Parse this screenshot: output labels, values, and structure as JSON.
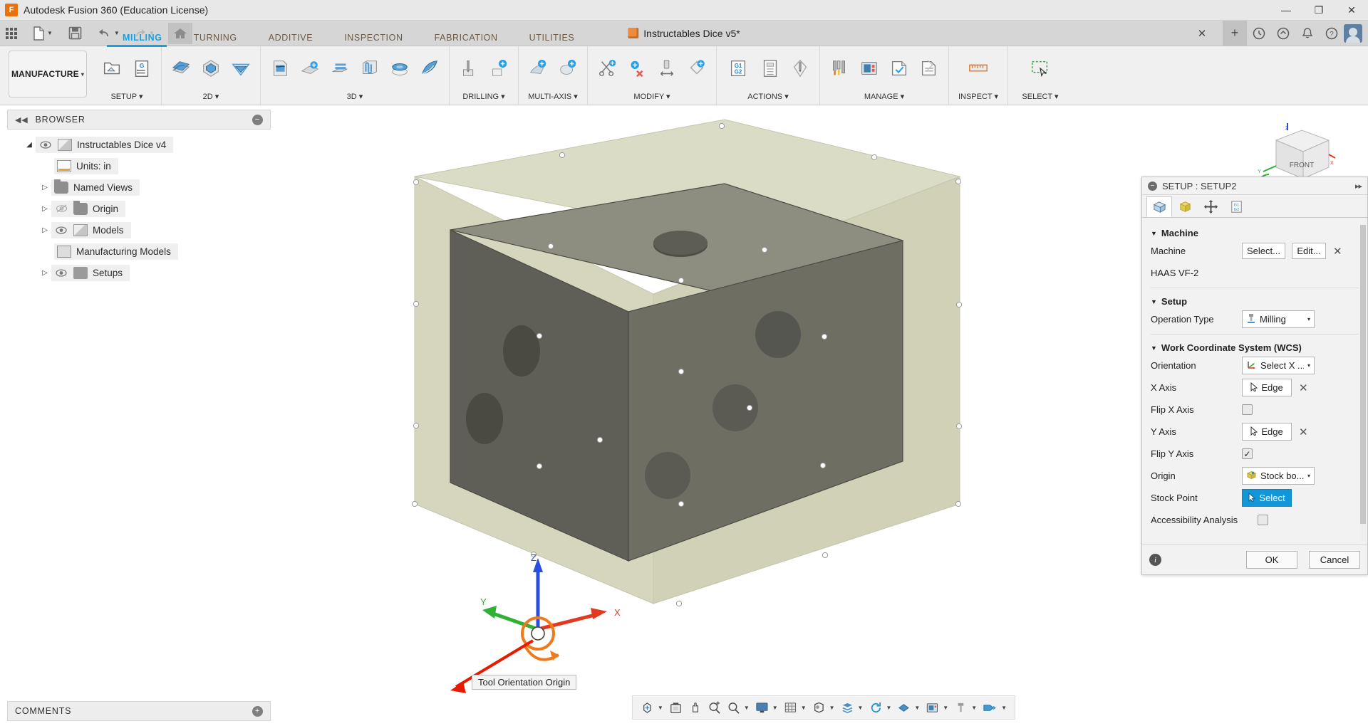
{
  "titlebar": {
    "app_title": "Autodesk Fusion 360 (Education License)",
    "minimize": "—",
    "maximize": "❐",
    "close": "✕",
    "logo_icon": "fusion-logo-icon"
  },
  "quick_access": {
    "grid_icon": "app-grid-icon",
    "new_icon": "new-document-icon",
    "save_icon": "save-icon",
    "undo_icon": "undo-icon",
    "redo_icon": "redo-icon",
    "home_icon": "home-icon",
    "document_name": "Instructables Dice v5*",
    "document_close": "✕",
    "add_tab": "+",
    "help_icon": "help-icon",
    "notify_icon": "notification-icon",
    "alerts_icon": "alerts-icon",
    "job_icon": "job-status-icon",
    "avatar": "user-avatar"
  },
  "ribbon": {
    "workspace": "MANUFACTURE",
    "workspace_caret": "▾",
    "tabs": [
      {
        "label": "MILLING",
        "active": true
      },
      {
        "label": "TURNING",
        "active": false
      },
      {
        "label": "ADDITIVE",
        "active": false
      },
      {
        "label": "INSPECTION",
        "active": false
      },
      {
        "label": "FABRICATION",
        "active": false
      },
      {
        "label": "UTILITIES",
        "active": false
      }
    ],
    "panels": [
      {
        "label": "SETUP ▾",
        "icons": [
          "setup-icon",
          "generate-nc-program-icon"
        ]
      },
      {
        "label": "2D ▾",
        "icons": [
          "face-icon",
          "adaptive-2d-icon",
          "pocket-2d-icon"
        ]
      },
      {
        "label": "3D ▾",
        "icons": [
          "adaptive-3d-icon",
          "pocket-clearing-icon",
          "parallel-icon",
          "contour-icon",
          "ramp-icon",
          "scallop-icon"
        ]
      },
      {
        "label": "DRILLING ▾",
        "icons": [
          "drill-icon",
          "bore-icon",
          "thread-icon"
        ]
      },
      {
        "label": "MULTI-AXIS ▾",
        "icons": [
          "swarf-icon",
          "multi-axis-contour-icon",
          "rotary-icon"
        ]
      },
      {
        "label": "MODIFY ▾",
        "icons": [
          "trim-icon",
          "delete-toolpath-icon",
          "extend-icon",
          "transform-icon"
        ]
      },
      {
        "label": "ACTIONS ▾",
        "icons": [
          "post-process-icon",
          "setup-sheet-icon",
          "simulate-icon"
        ]
      },
      {
        "label": "MANAGE ▾",
        "icons": [
          "tool-library-icon",
          "machine-library-icon",
          "generate-icon",
          "template-icon"
        ]
      },
      {
        "label": "INSPECT ▾",
        "icons": [
          "measure-icon"
        ]
      },
      {
        "label": "SELECT ▾",
        "icons": [
          "select-window-icon"
        ]
      }
    ]
  },
  "browser": {
    "title": "BROWSER",
    "collapse_icon": "collapse-left-icon",
    "minimize_icon": "−",
    "nodes": [
      {
        "label": "Instructables Dice v4",
        "indent": 0,
        "arrow": "◢",
        "eye": true,
        "icon": "body-icon"
      },
      {
        "label": "Units: in",
        "indent": 1,
        "arrow": "",
        "eye": false,
        "icon": "units-document-icon"
      },
      {
        "label": "Named Views",
        "indent": 1,
        "arrow": "▷",
        "eye": false,
        "icon": "folder-icon"
      },
      {
        "label": "Origin",
        "indent": 1,
        "arrow": "▷",
        "eye": true,
        "eye_off": true,
        "icon": "folder-icon"
      },
      {
        "label": "Models",
        "indent": 1,
        "arrow": "▷",
        "eye": true,
        "icon": "body-icon"
      },
      {
        "label": "Manufacturing Models",
        "indent": 1,
        "arrow": "",
        "eye": false,
        "icon": "manufacturing-model-icon"
      },
      {
        "label": "Setups",
        "indent": 1,
        "arrow": "▷",
        "eye": true,
        "icon": "folder-open-icon"
      }
    ]
  },
  "comments": {
    "title": "COMMENTS",
    "add_icon": "+"
  },
  "canvas": {
    "tooltip": "Tool Orientation Origin",
    "viewcube": {
      "front_label": "FRONT",
      "z_label": "Z",
      "x_label": "X",
      "y_label": "Y"
    },
    "triad": {
      "x": "X",
      "y": "Y",
      "z": "Z"
    },
    "colors": {
      "stock": "#cfd0b3",
      "model": "#6e6e63",
      "x_axis": "#e23a1e",
      "y_axis": "#2fb134",
      "z_axis": "#2a4fe0",
      "highlight": "#f07a1a"
    }
  },
  "navbar": {
    "items": [
      {
        "icon": "orbit-icon",
        "caret": true
      },
      {
        "icon": "look-at-icon",
        "caret": false
      },
      {
        "icon": "pan-icon",
        "caret": false
      },
      {
        "icon": "zoom-in-icon",
        "caret": false
      },
      {
        "icon": "zoom-window-icon",
        "caret": true
      },
      {
        "icon": "display-settings-icon",
        "caret": true
      },
      {
        "icon": "grid-snaps-icon",
        "caret": true
      },
      {
        "icon": "viewports-icon",
        "caret": true
      },
      {
        "icon": "layers-icon",
        "caret": true
      },
      {
        "icon": "refresh-icon",
        "caret": true
      },
      {
        "icon": "appearance-icon",
        "caret": true
      },
      {
        "icon": "machine-view-icon",
        "caret": true
      },
      {
        "icon": "tool-view-icon",
        "caret": true
      },
      {
        "icon": "simulation-icon",
        "caret": true
      }
    ]
  },
  "dialog": {
    "title": "SETUP : SETUP2",
    "collapse_icon": "−",
    "expand_icon": "▸▸",
    "tabs": [
      {
        "icon": "setup-tab-icon",
        "active": true
      },
      {
        "icon": "stock-tab-icon",
        "active": false
      },
      {
        "icon": "post-process-tab-icon",
        "active": false
      },
      {
        "icon": "program-tab-icon",
        "active": false
      }
    ],
    "sections": [
      {
        "title": "Machine",
        "rows": [
          {
            "type": "buttons",
            "label": "Machine",
            "buttons": [
              "Select...",
              "Edit..."
            ],
            "clear": "✕"
          },
          {
            "type": "text",
            "label": "",
            "value": "HAAS VF-2"
          }
        ]
      },
      {
        "title": "Setup",
        "rows": [
          {
            "type": "select",
            "label": "Operation Type",
            "value": "Milling",
            "icon": "milling-icon",
            "caret": "▾"
          }
        ]
      },
      {
        "title": "Work Coordinate System (WCS)",
        "rows": [
          {
            "type": "select",
            "label": "Orientation",
            "value": "Select X ...",
            "icon": "axis-triad-icon",
            "caret": "▾"
          },
          {
            "type": "pick",
            "label": "X Axis",
            "value": "Edge",
            "icon": "cursor-icon",
            "clear": "✕"
          },
          {
            "type": "checkbox",
            "label": "Flip X Axis",
            "checked": false
          },
          {
            "type": "pick",
            "label": "Y Axis",
            "value": "Edge",
            "icon": "cursor-icon",
            "clear": "✕"
          },
          {
            "type": "checkbox",
            "label": "Flip Y Axis",
            "checked": true
          },
          {
            "type": "select",
            "label": "Origin",
            "value": "Stock bo...",
            "icon": "stock-box-icon",
            "caret": "▾"
          },
          {
            "type": "pick-blue",
            "label": "Stock Point",
            "value": "Select",
            "icon": "cursor-icon"
          },
          {
            "type": "checkbox",
            "label": "Accessibility Analysis",
            "checked": false
          }
        ]
      }
    ],
    "footer": {
      "info_icon": "i",
      "ok": "OK",
      "cancel": "Cancel"
    }
  }
}
